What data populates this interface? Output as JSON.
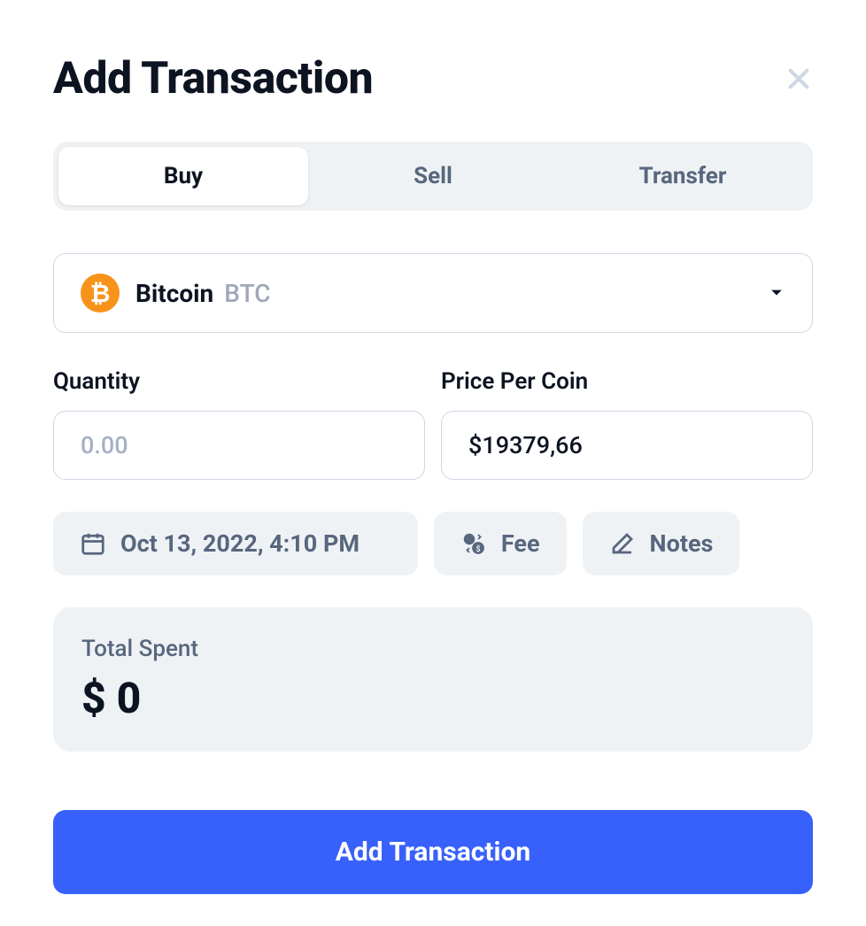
{
  "header": {
    "title": "Add Transaction"
  },
  "tabs": {
    "buy": "Buy",
    "sell": "Sell",
    "transfer": "Transfer"
  },
  "coin": {
    "name": "Bitcoin",
    "symbol": "BTC",
    "icon": "₿"
  },
  "quantity": {
    "label": "Quantity",
    "placeholder": "0.00",
    "value": ""
  },
  "price": {
    "label": "Price Per Coin",
    "value": "$19379,66"
  },
  "chips": {
    "date": "Oct 13, 2022, 4:10 PM",
    "fee": "Fee",
    "notes": "Notes"
  },
  "total": {
    "label": "Total Spent",
    "value": "$ 0"
  },
  "submit": {
    "label": "Add Transaction"
  }
}
